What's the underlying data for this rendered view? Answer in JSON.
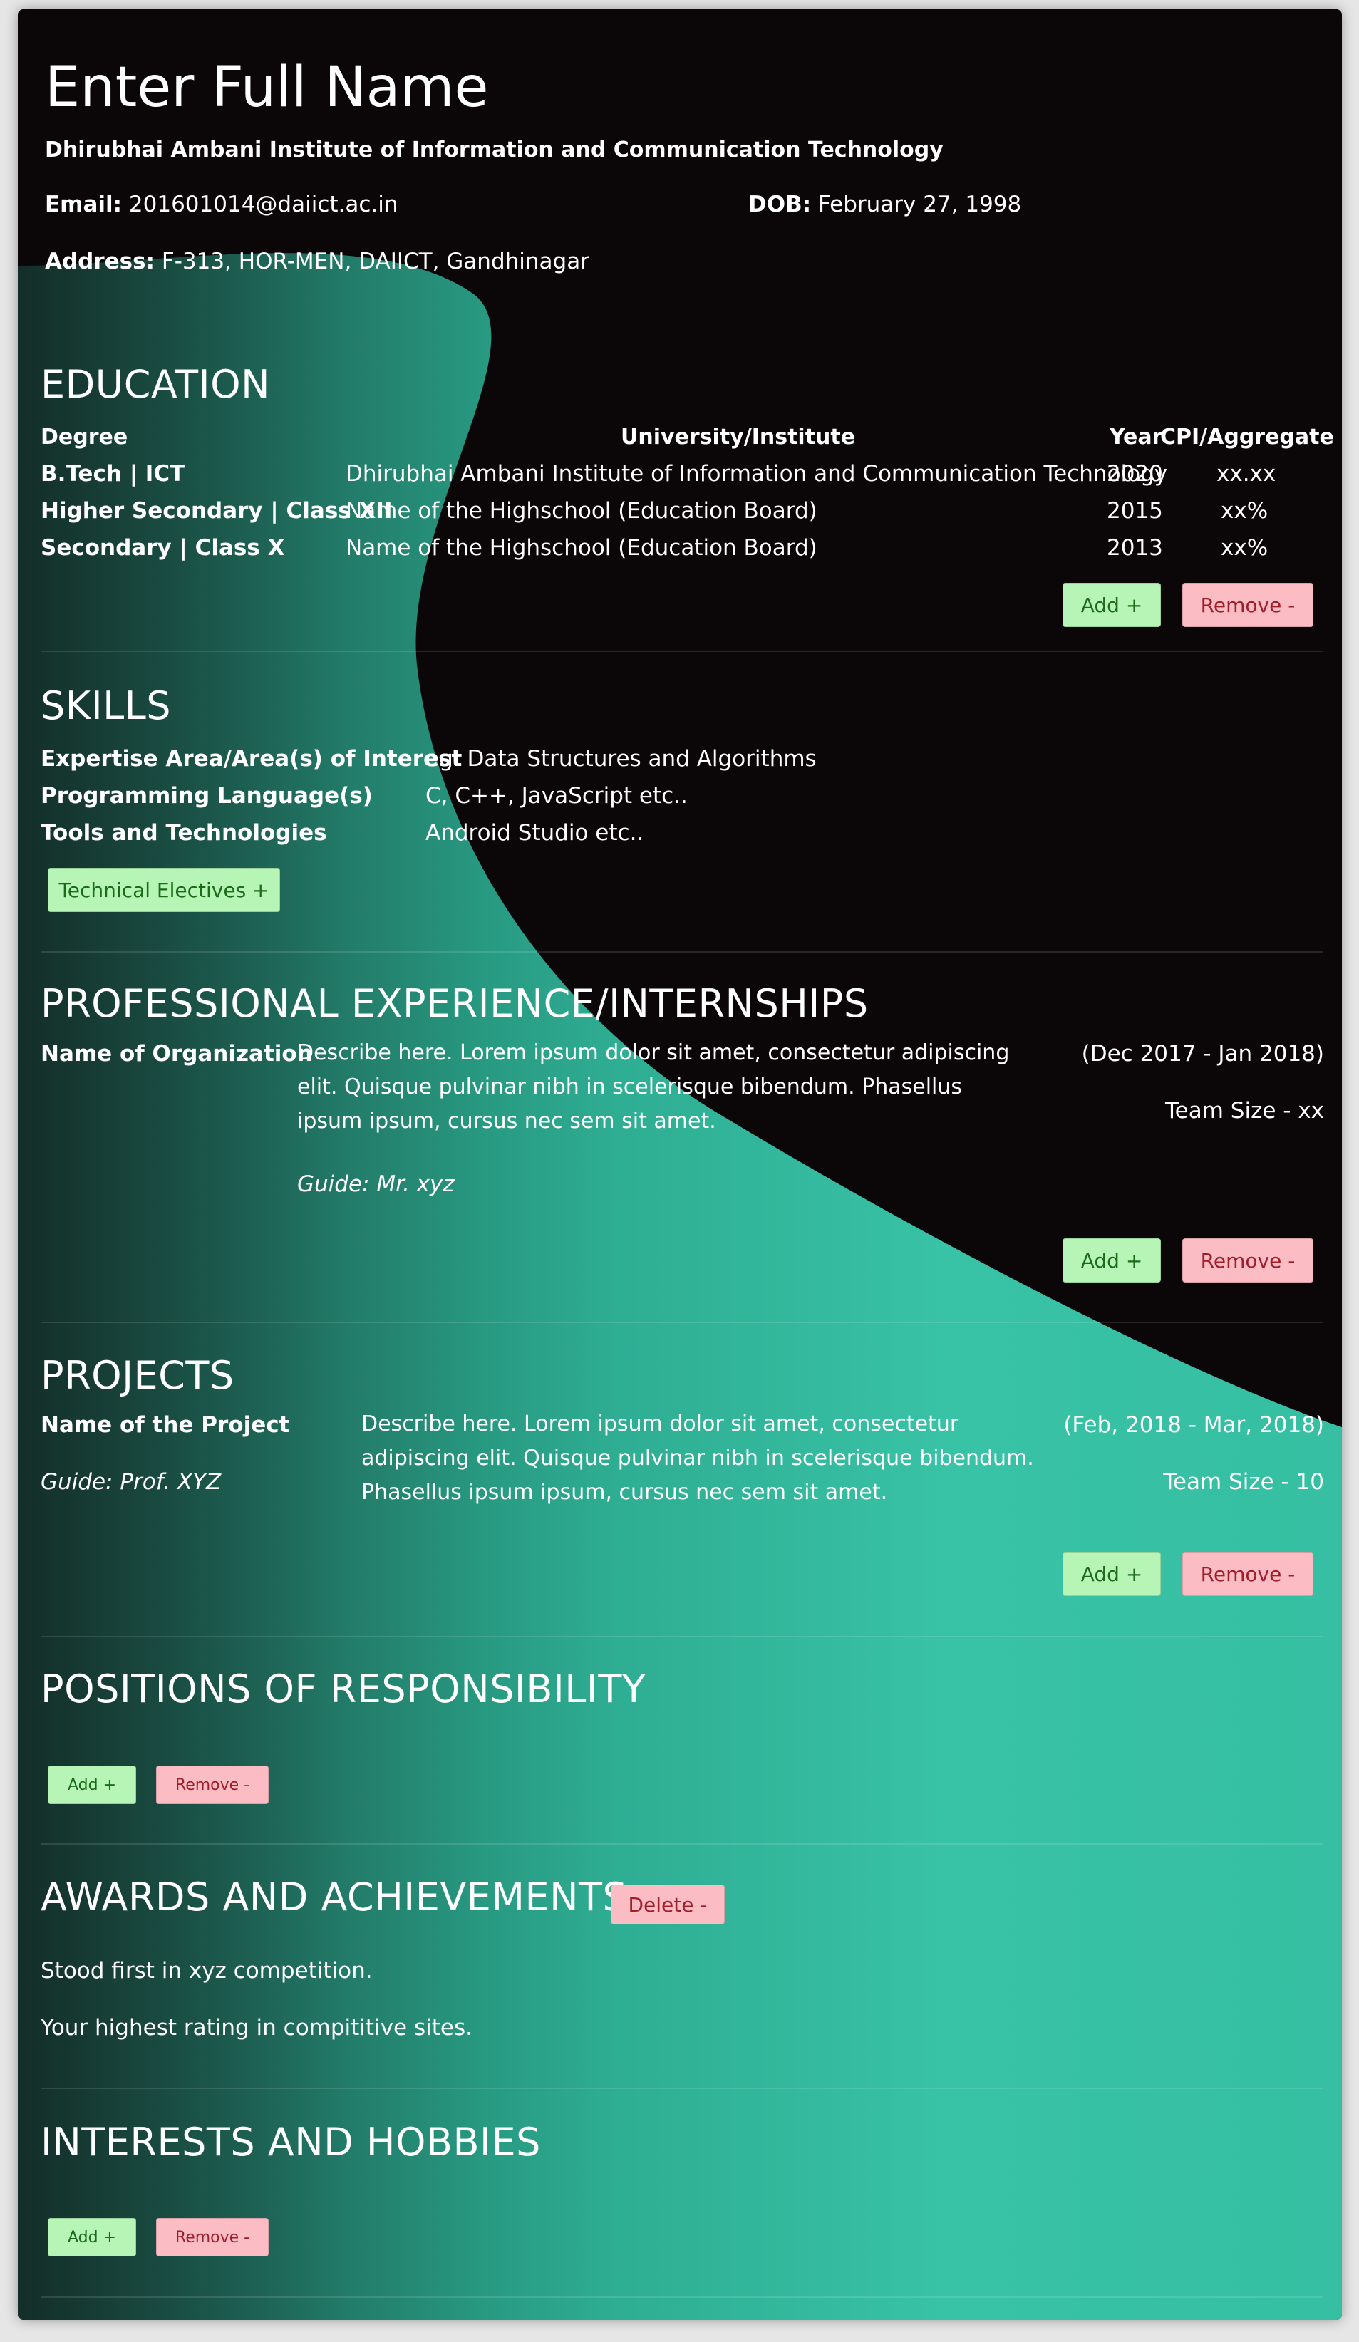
{
  "header": {
    "name": "Enter Full Name",
    "institute": "Dhirubhai Ambani Institute of Information and Communication Technology",
    "email_label": "Email:",
    "email": "201601014@daiict.ac.in",
    "dob_label": "DOB:",
    "dob": "February 27, 1998",
    "address_label": "Address:",
    "address": "F-313, HOR-MEN, DAIICT, Gandhinagar"
  },
  "education": {
    "title": "EDUCATION",
    "headers": {
      "degree": "Degree",
      "university": "University/Institute",
      "year": "Year",
      "cpi": "CPI/Aggregate"
    },
    "rows": [
      {
        "degree": "B.Tech | ICT",
        "university": "Dhirubhai Ambani Institute of Information and Communication Technology",
        "year": "2020",
        "cpi": "xx.xx"
      },
      {
        "degree": "Higher Secondary | Class XII",
        "university": "Name of the Highschool (Education Board)",
        "year": "2015",
        "cpi": "xx%"
      },
      {
        "degree": "Secondary | Class X",
        "university": "Name of the Highschool (Education Board)",
        "year": "2013",
        "cpi": "xx%"
      }
    ],
    "add_label": "Add +",
    "remove_label": "Remove -"
  },
  "skills": {
    "title": "SKILLS",
    "rows": [
      {
        "label": "Expertise Area/Area(s) of Interest",
        "value": "eg. Data Structures and Algorithms"
      },
      {
        "label": "Programming Language(s)",
        "value": "C, C++, JavaScript etc.."
      },
      {
        "label": "Tools and Technologies",
        "value": "Android Studio etc.."
      }
    ],
    "electives_label": "Technical Electives +"
  },
  "experience": {
    "title": "PROFESSIONAL EXPERIENCE/INTERNSHIPS",
    "org": "Name of Organization",
    "description": "Describe here. Lorem ipsum dolor sit amet, consectetur adipiscing elit. Quisque pulvinar nibh in scelerisque bibendum. Phasellus ipsum ipsum, cursus nec sem sit amet.",
    "guide": "Guide: Mr. xyz",
    "dates": "(Dec 2017 - Jan 2018)",
    "team": "Team Size - xx",
    "add_label": "Add +",
    "remove_label": "Remove -"
  },
  "projects": {
    "title": "PROJECTS",
    "name": "Name of the Project",
    "guide": "Guide: Prof. XYZ",
    "description": "Describe here. Lorem ipsum dolor sit amet, consectetur adipiscing elit. Quisque pulvinar nibh in scelerisque bibendum. Phasellus ipsum ipsum, cursus nec sem sit amet.",
    "dates": "(Feb, 2018 - Mar, 2018)",
    "team": "Team Size - 10",
    "add_label": "Add +",
    "remove_label": "Remove -"
  },
  "positions": {
    "title": "POSITIONS OF RESPONSIBILITY",
    "add_label": "Add +",
    "remove_label": "Remove -"
  },
  "awards": {
    "title": "AWARDS AND ACHIEVEMENTS",
    "delete_label": "Delete -",
    "items": [
      "Stood first in xyz competition.",
      "Your highest rating in compititive sites."
    ]
  },
  "interests": {
    "title": "INTERESTS AND HOBBIES",
    "add_label": "Add +",
    "remove_label": "Remove -"
  },
  "colors": {
    "dark": "#0b0607",
    "teal": "#36c0a3",
    "add_bg": "#b6f5b6",
    "remove_bg": "#fbbcc4"
  }
}
